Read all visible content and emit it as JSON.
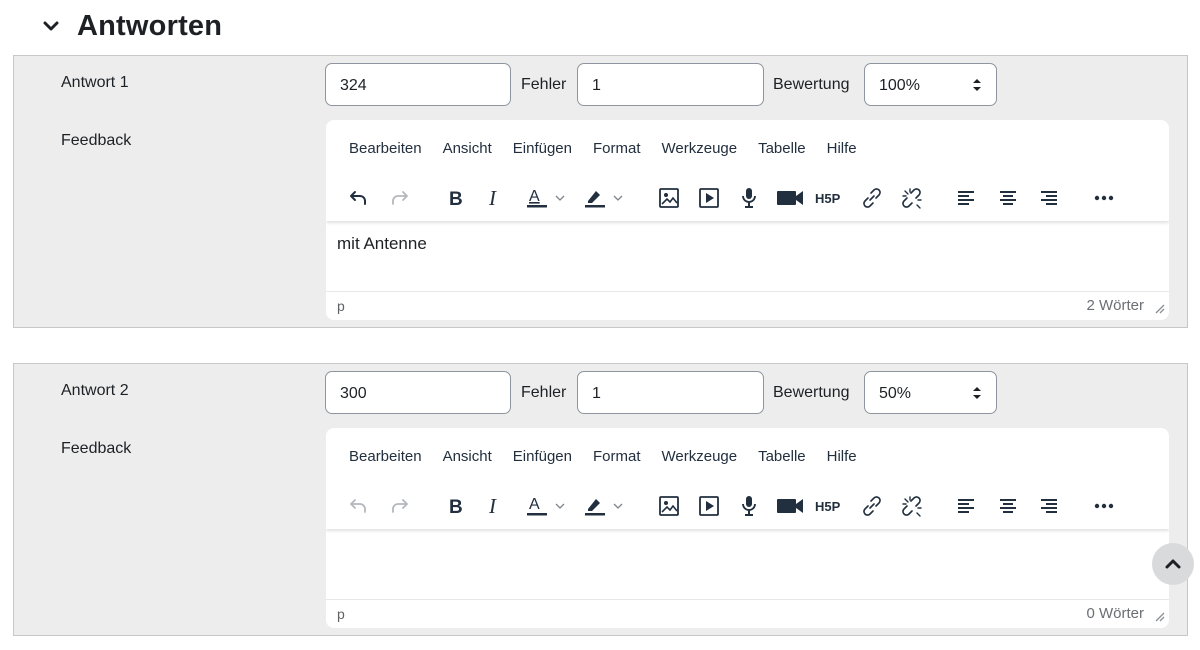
{
  "section": {
    "title": "Antworten"
  },
  "menu": [
    "Bearbeiten",
    "Ansicht",
    "Einfügen",
    "Format",
    "Werkzeuge",
    "Tabelle",
    "Hilfe"
  ],
  "labels": {
    "fehler": "Fehler",
    "bewertung": "Bewertung",
    "feedback": "Feedback"
  },
  "answers": [
    {
      "label": "Antwort 1",
      "answer_value": "324",
      "fehler_value": "1",
      "bewertung_value": "100%",
      "feedback_text": "mit Antenne",
      "path": "p",
      "wordcount": "2 Wörter",
      "undo_enabled": true
    },
    {
      "label": "Antwort 2",
      "answer_value": "300",
      "fehler_value": "1",
      "bewertung_value": "50%",
      "feedback_text": "",
      "path": "p",
      "wordcount": "0 Wörter",
      "undo_enabled": false
    }
  ],
  "toolbar_icons": [
    "undo-icon",
    "redo-icon",
    "bold-icon",
    "italic-icon",
    "text-color-icon",
    "highlight-color-icon",
    "image-icon",
    "media-icon",
    "record-audio-icon",
    "record-video-icon",
    "h5p-icon",
    "link-icon",
    "unlink-icon",
    "align-left-icon",
    "align-center-icon",
    "align-right-icon",
    "more-icon"
  ],
  "colors": {
    "icon": "#222f3e",
    "disabled_icon": "#b4b8bc",
    "block_bg": "#ededed",
    "border": "#8f959e"
  }
}
